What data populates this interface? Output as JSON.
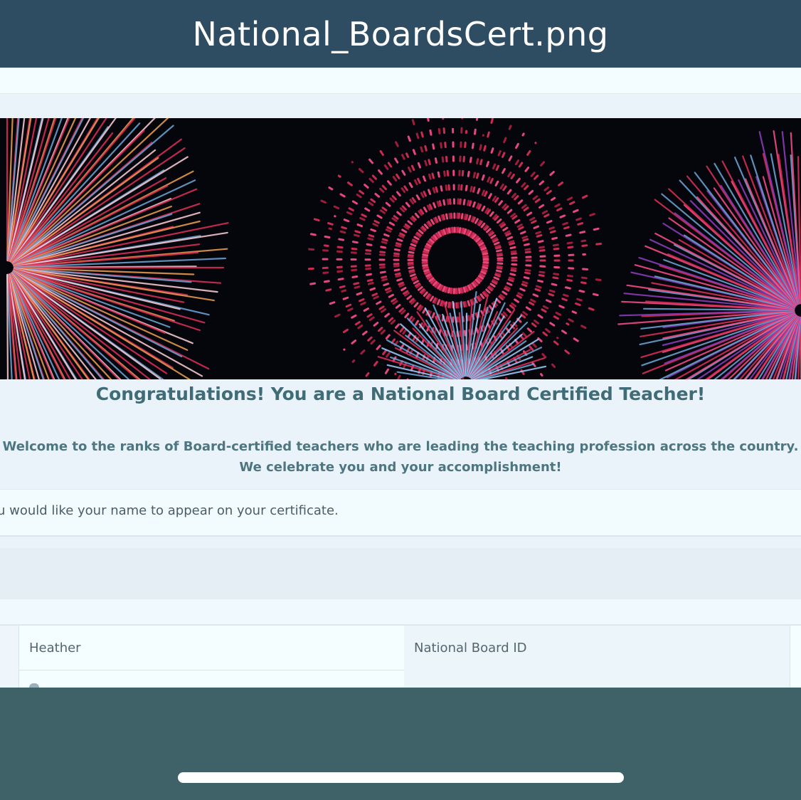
{
  "window": {
    "title": "National_BoardsCert.png"
  },
  "banner": {
    "image": "fireworks-banner",
    "colors": {
      "background": "#05060c",
      "red": "#e0305a",
      "pink": "#ff4f8a",
      "orange": "#f0a050",
      "blue": "#6ea8d8"
    }
  },
  "page": {
    "heading": "Congratulations! You are a National Board Certified Teacher!",
    "welcome_line1": "Welcome to the ranks of Board-certified teachers who are leading the teaching profession across the country.",
    "welcome_line2": "We celebrate you and your accomplishment!",
    "instruction": "u would like your name to appear on your certificate."
  },
  "form": {
    "first_name_value": "Heather",
    "national_board_id_placeholder": "National Board ID"
  },
  "colors": {
    "title_bar": "#2e4c62",
    "heading": "#3f6c76",
    "outer_background": "#3f6168"
  }
}
